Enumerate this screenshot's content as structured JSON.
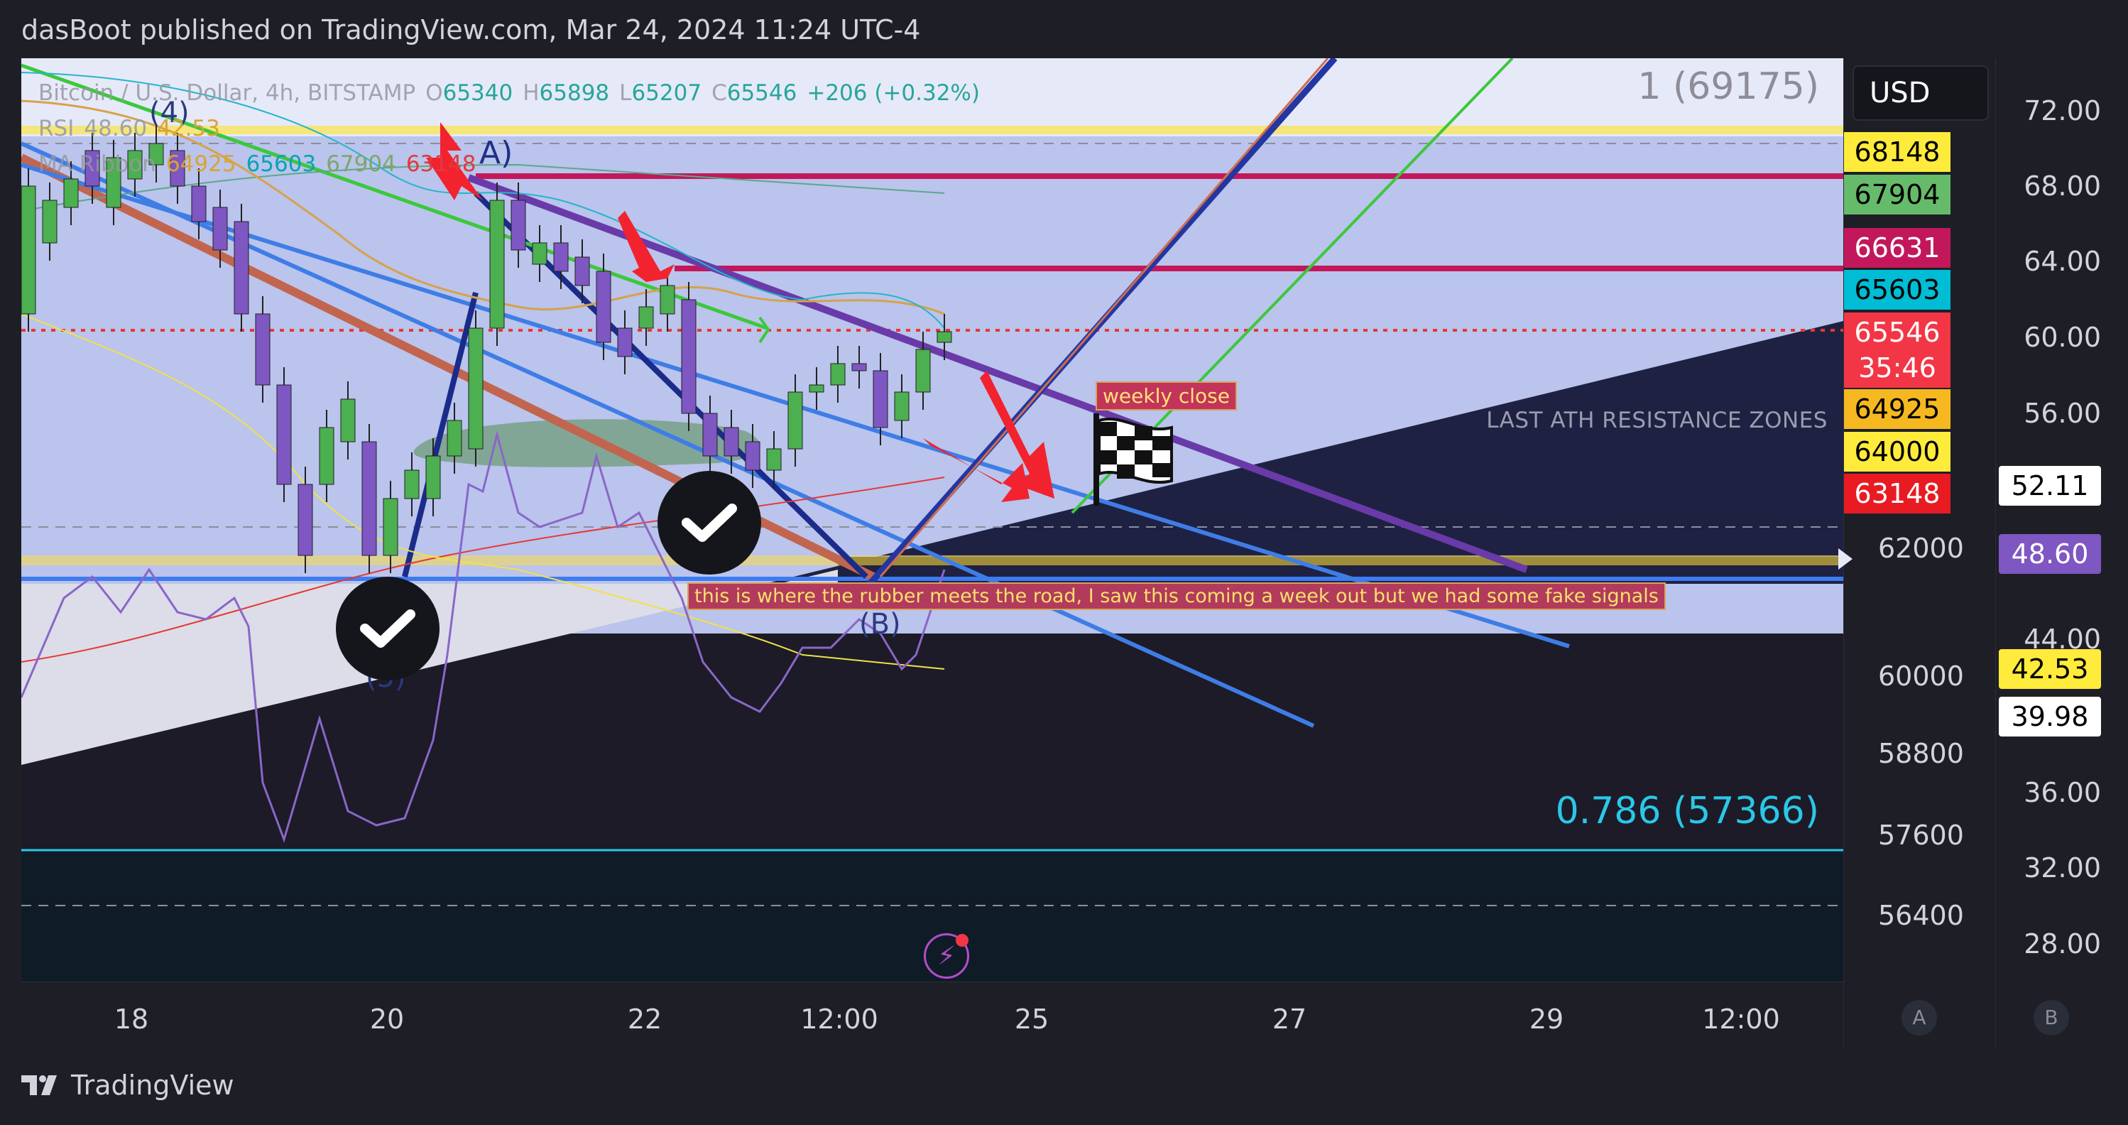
{
  "header": {
    "published": "dasBoot published on TradingView.com, Mar 24, 2024 11:24 UTC-4"
  },
  "legend": {
    "symbol": "Bitcoin / U.S. Dollar, 4h, BITSTAMP",
    "open_prefix": "O",
    "open": "65340",
    "high_prefix": "H",
    "high": "65898",
    "low_prefix": "L",
    "low": "65207",
    "close_prefix": "C",
    "close": "65546",
    "change": "+206 (+0.32%)",
    "rsi_label": "RSI",
    "rsi_value": "48.60",
    "rsi_value2": "42.53",
    "ma_label": "MA Ribbon",
    "ma_values": [
      "64925",
      "65603",
      "67904",
      "63148"
    ]
  },
  "fib": {
    "top": "1 (69175)",
    "level_786": "0.786 (57366)"
  },
  "annotations": {
    "zone": "LAST ATH RESISTANCE ZONES",
    "weekly": "weekly close",
    "rubber": "this is where the rubber meets the road, I saw this coming a week out but we had some fake signals",
    "wave_a": "A)",
    "wave_4": "(4)",
    "wave_5": "(5)",
    "wave_b": "(B)"
  },
  "x_axis": [
    "18",
    "20",
    "22",
    "12:00",
    "25",
    "27",
    "29",
    "12:00"
  ],
  "price_axis": {
    "currency": "USD",
    "ticks": [
      "62000",
      "60000",
      "58800",
      "57600",
      "56400"
    ],
    "badges": [
      {
        "text": "68148",
        "bg": "#ffeb3b",
        "fg": "#000000"
      },
      {
        "text": "67904",
        "bg": "#66bb6a",
        "fg": "#000000"
      },
      {
        "text": "66631",
        "bg": "#c2185b",
        "fg": "#ffffff"
      },
      {
        "text": "65603",
        "bg": "#00bcd4",
        "fg": "#000000"
      },
      {
        "text": "65546",
        "bg": "#f23645",
        "fg": "#ffffff"
      },
      {
        "text": "35:46",
        "bg": "#f23645",
        "fg": "#ffffff"
      },
      {
        "text": "64925",
        "bg": "#f5b820",
        "fg": "#000000"
      },
      {
        "text": "64000",
        "bg": "#ffeb3b",
        "fg": "#000000"
      },
      {
        "text": "63148",
        "bg": "#e81b23",
        "fg": "#ffffff"
      }
    ]
  },
  "rsi_axis": {
    "ticks": [
      "72.00",
      "68.00",
      "64.00",
      "60.00",
      "56.00",
      "44.00",
      "36.00",
      "32.00",
      "28.00"
    ],
    "badges": [
      {
        "text": "52.11",
        "bg": "#ffffff",
        "fg": "#000000"
      },
      {
        "text": "48.60",
        "bg": "#7e57c2",
        "fg": "#ffffff"
      },
      {
        "text": "42.53",
        "bg": "#ffeb3b",
        "fg": "#000000"
      },
      {
        "text": "39.98",
        "bg": "#ffffff",
        "fg": "#000000"
      }
    ],
    "button_a": "A",
    "button_b": "B"
  },
  "footer": {
    "brand": "TradingView"
  },
  "colors": {
    "up": "#4caf50",
    "down": "#7e57c2",
    "fib_786": "#2bc7e8",
    "resistance_zone": "#b9c3ec"
  }
}
